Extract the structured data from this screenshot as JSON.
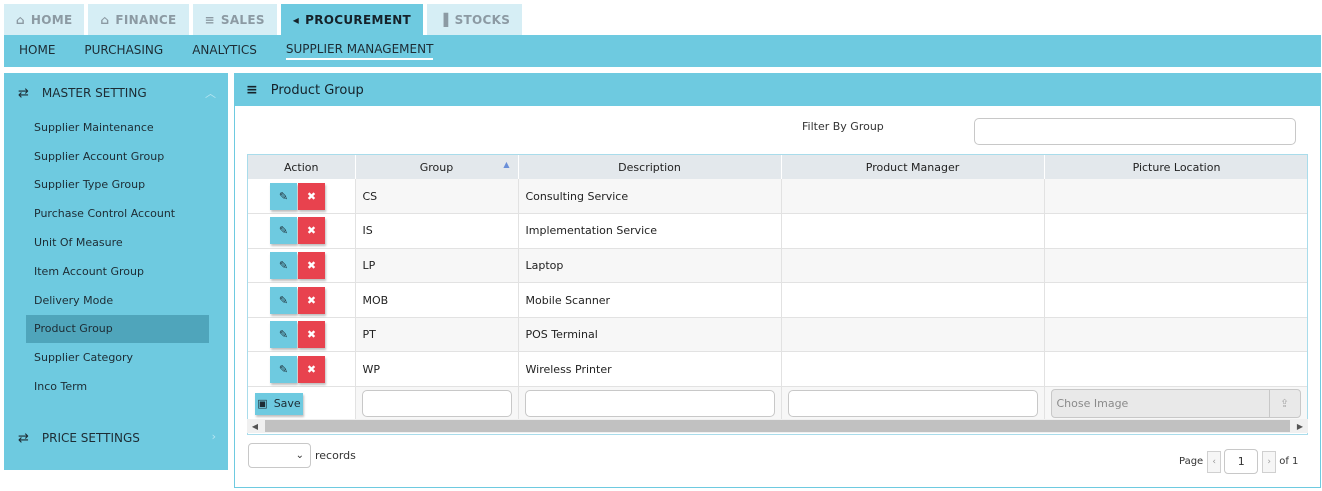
{
  "top_tabs": [
    {
      "label": "HOME",
      "icon": "home-icon",
      "glyph": "⌂"
    },
    {
      "label": "FINANCE",
      "icon": "bank-icon",
      "glyph": "🏛"
    },
    {
      "label": "SALES",
      "icon": "cart-icon",
      "glyph": "🛒"
    },
    {
      "label": "PROCUREMENT",
      "icon": "bullhorn-icon",
      "glyph": "📢"
    },
    {
      "label": "STOCKS",
      "icon": "chart-icon",
      "glyph": "▮"
    }
  ],
  "sub_nav": [
    "HOME",
    "PURCHASING",
    "ANALYTICS",
    "SUPPLIER MANAGEMENT"
  ],
  "sidebar": {
    "master_label": "MASTER SETTING",
    "items": [
      "Supplier Maintenance",
      "Supplier Account Group",
      "Supplier Type Group",
      "Purchase Control Account",
      "Unit Of Measure",
      "Item Account Group",
      "Delivery Mode",
      "Product Group",
      "Supplier Category",
      "Inco Term"
    ],
    "price_label": "PRICE SETTINGS"
  },
  "panel": {
    "title": "Product Group",
    "filter_label": "Filter By Group"
  },
  "grid": {
    "columns": [
      "Action",
      "Group",
      "Description",
      "Product Manager",
      "Picture Location"
    ],
    "rows": [
      {
        "group": "CS",
        "description": "Consulting Service",
        "manager": "",
        "picture": ""
      },
      {
        "group": "IS",
        "description": "Implementation Service",
        "manager": "",
        "picture": ""
      },
      {
        "group": "LP",
        "description": "Laptop",
        "manager": "",
        "picture": ""
      },
      {
        "group": "MOB",
        "description": "Mobile Scanner",
        "manager": "",
        "picture": ""
      },
      {
        "group": "PT",
        "description": "POS Terminal",
        "manager": "",
        "picture": ""
      },
      {
        "group": "WP",
        "description": "Wireless Printer",
        "manager": "",
        "picture": ""
      }
    ],
    "save_label": "Save",
    "chose_image_placeholder": "Chose Image"
  },
  "footer": {
    "records_label": "records",
    "page_label": "Page",
    "page_number": "1",
    "of_label": "of 1"
  },
  "colors": {
    "accent": "#6ecae0",
    "delete": "#e8424e",
    "active_side": "#4fa5bb"
  }
}
